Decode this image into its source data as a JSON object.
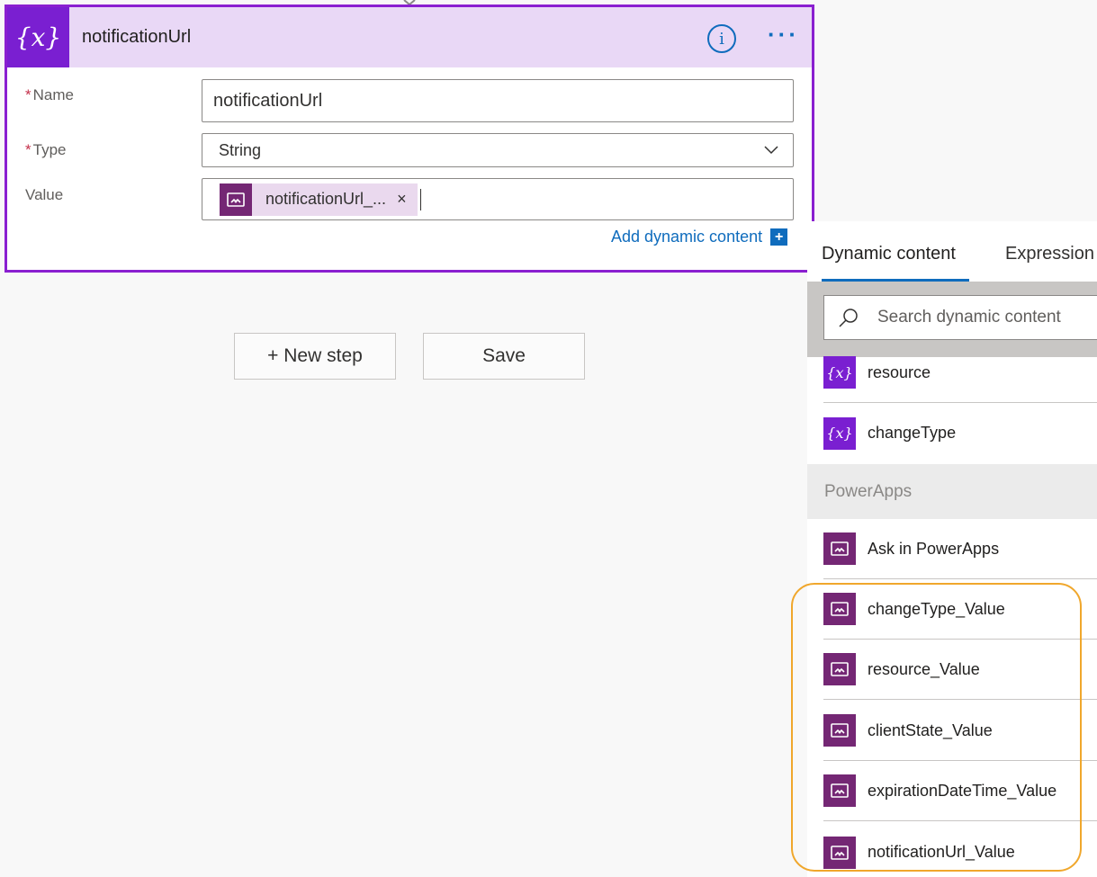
{
  "action_card": {
    "icon": "variable-icon",
    "icon_glyph": "{x}",
    "title": "notificationUrl",
    "fields": {
      "name": {
        "label": "Name",
        "required_mark": "*",
        "value": "notificationUrl"
      },
      "type": {
        "label": "Type",
        "required_mark": "*",
        "value": "String"
      },
      "value": {
        "label": "Value",
        "token_label": "notificationUrl_...",
        "token_remove": "×"
      }
    },
    "add_dynamic_content": {
      "label": "Add dynamic content",
      "plus": "+"
    }
  },
  "buttons": {
    "new_step": "+ New step",
    "save": "Save"
  },
  "dynamic_panel": {
    "tabs": [
      "Dynamic content",
      "Expression"
    ],
    "active_tab": "Dynamic content",
    "search": {
      "placeholder": "Search dynamic content"
    },
    "variables": [
      {
        "label": "resource",
        "icon": "variable-icon",
        "glyph": "{x}"
      },
      {
        "label": "changeType",
        "icon": "variable-icon",
        "glyph": "{x}"
      }
    ],
    "section_header": "PowerApps",
    "powerapps_items": [
      {
        "label": "Ask in PowerApps",
        "icon": "powerapps-icon"
      },
      {
        "label": "changeType_Value",
        "icon": "powerapps-icon"
      },
      {
        "label": "resource_Value",
        "icon": "powerapps-icon"
      },
      {
        "label": "clientState_Value",
        "icon": "powerapps-icon"
      },
      {
        "label": "expirationDateTime_Value",
        "icon": "powerapps-icon"
      },
      {
        "label": "notificationUrl_Value",
        "icon": "powerapps-icon"
      }
    ]
  },
  "colors": {
    "card_border": "#8a1fd0",
    "header_bg": "#e9d8f6",
    "variable_icon_bg": "#7a1fd1",
    "powerapps_icon_bg": "#742774",
    "link_blue": "#0f6cbd",
    "highlight": "#f0a72c"
  }
}
